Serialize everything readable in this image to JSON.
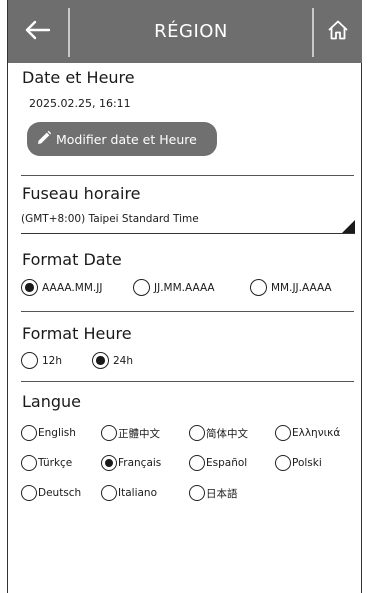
{
  "header": {
    "title": "RÉGION",
    "back_icon": "arrow-left-icon",
    "home_icon": "home-icon"
  },
  "datetime": {
    "section_title": "Date et Heure",
    "value": "2025.02.25, 16:11",
    "modify_label": "Modifier date et Heure",
    "modify_icon": "pencil-icon"
  },
  "timezone": {
    "section_title": "Fuseau horaire",
    "value": "(GMT+8:00) Taipei Standard Time"
  },
  "date_format": {
    "section_title": "Format Date",
    "options": [
      "AAAA.MM.JJ",
      "JJ.MM.AAAA",
      "MM.JJ.AAAA"
    ],
    "selected": "AAAA.MM.JJ"
  },
  "time_format": {
    "section_title": "Format Heure",
    "options": [
      "12h",
      "24h"
    ],
    "selected": "24h"
  },
  "language": {
    "section_title": "Langue",
    "options": [
      "English",
      "正體中文",
      "简体中文",
      "Ελληνικά",
      "Türkçe",
      "Français",
      "Español",
      "Polski",
      "Deutsch",
      "Italiano",
      "日本語"
    ],
    "selected": "Français"
  },
  "colors": {
    "header_bg": "#6e6e6e",
    "button_bg": "#707070",
    "text": "#1a1a1a"
  }
}
